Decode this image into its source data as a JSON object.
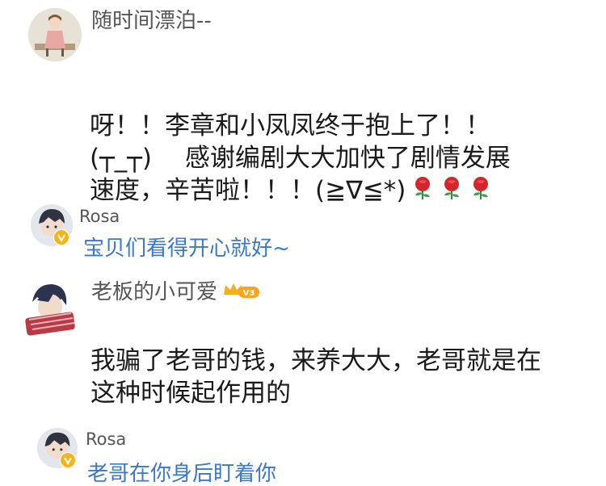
{
  "comments": [
    {
      "username": "随时间漂泊--",
      "text": "呀！！李章和小凤凤终于抱上了！！\n(┬_┬)　 感谢编剧大大加快了剧情发展\n速度，辛苦啦！！！(≧∇≦*)",
      "emoji": "rose-emoji",
      "emoji_count": 3,
      "reply": {
        "username": "Rosa",
        "text": "宝贝们看得开心就好~"
      }
    },
    {
      "username": "老板的小可爱",
      "vip_label": "V3",
      "text": "我骗了老哥的钱，来养大大，老哥就是在\n这种时候起作用的",
      "reply": {
        "username": "Rosa",
        "text": "老哥在你身后盯着你"
      }
    }
  ],
  "colors": {
    "reply_text": "#3b78c8",
    "username": "#555555",
    "body_text": "#1a1a1a",
    "badge": "#f2b51c"
  }
}
